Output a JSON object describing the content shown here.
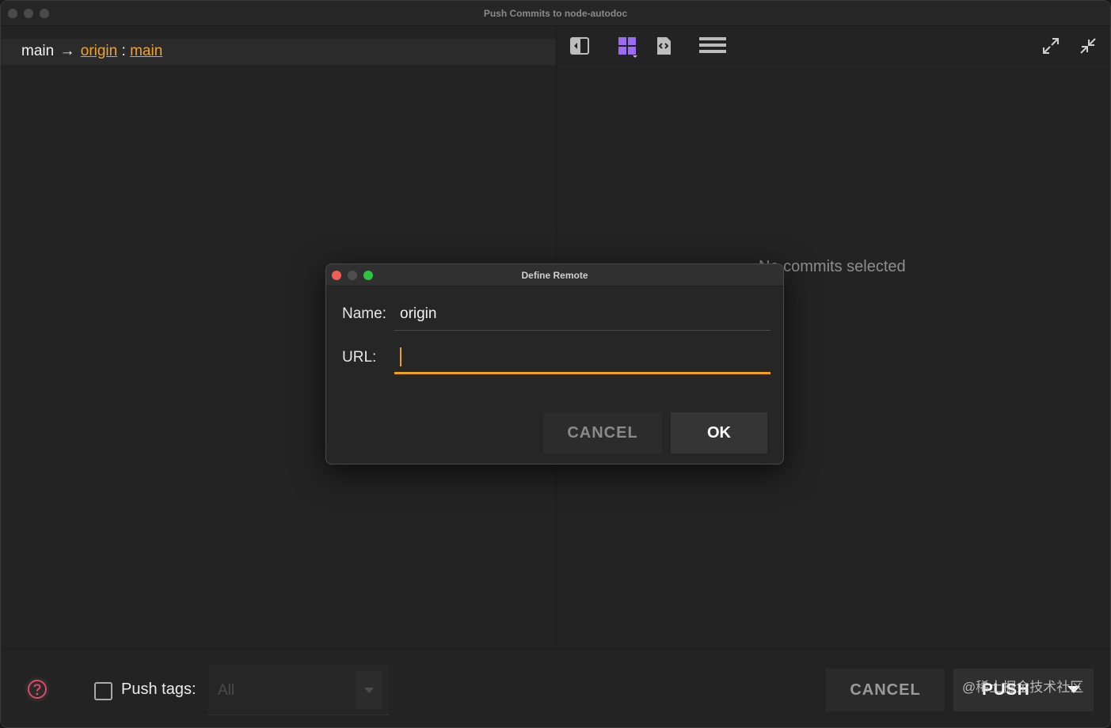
{
  "window": {
    "title": "Push Commits to node-autodoc"
  },
  "branch": {
    "local": "main",
    "arrow": "→",
    "remote": "origin",
    "sep": ":",
    "remote_branch": "main"
  },
  "right_pane": {
    "empty_message": "No commits selected"
  },
  "toolbar": {
    "icons": [
      "split-view-icon",
      "grid-view-icon",
      "code-file-icon",
      "list-view-icon",
      "expand-icon",
      "collapse-icon"
    ],
    "accent": "#9b6cf3"
  },
  "dialog": {
    "title": "Define Remote",
    "name_label": "Name:",
    "name_value": "origin",
    "url_label": "URL:",
    "url_value": "",
    "cancel_label": "CANCEL",
    "ok_label": "OK"
  },
  "footer": {
    "push_tags_label": "Push tags:",
    "push_tags_checked": false,
    "tags_select_value": "All",
    "cancel_label": "CANCEL",
    "push_label": "PUSH"
  },
  "colors": {
    "accent": "#f0a01a",
    "help": "#e5486a",
    "close": "#ee5e57",
    "maximize": "#2ec541"
  },
  "watermark": "@稀土掘金技术社区"
}
